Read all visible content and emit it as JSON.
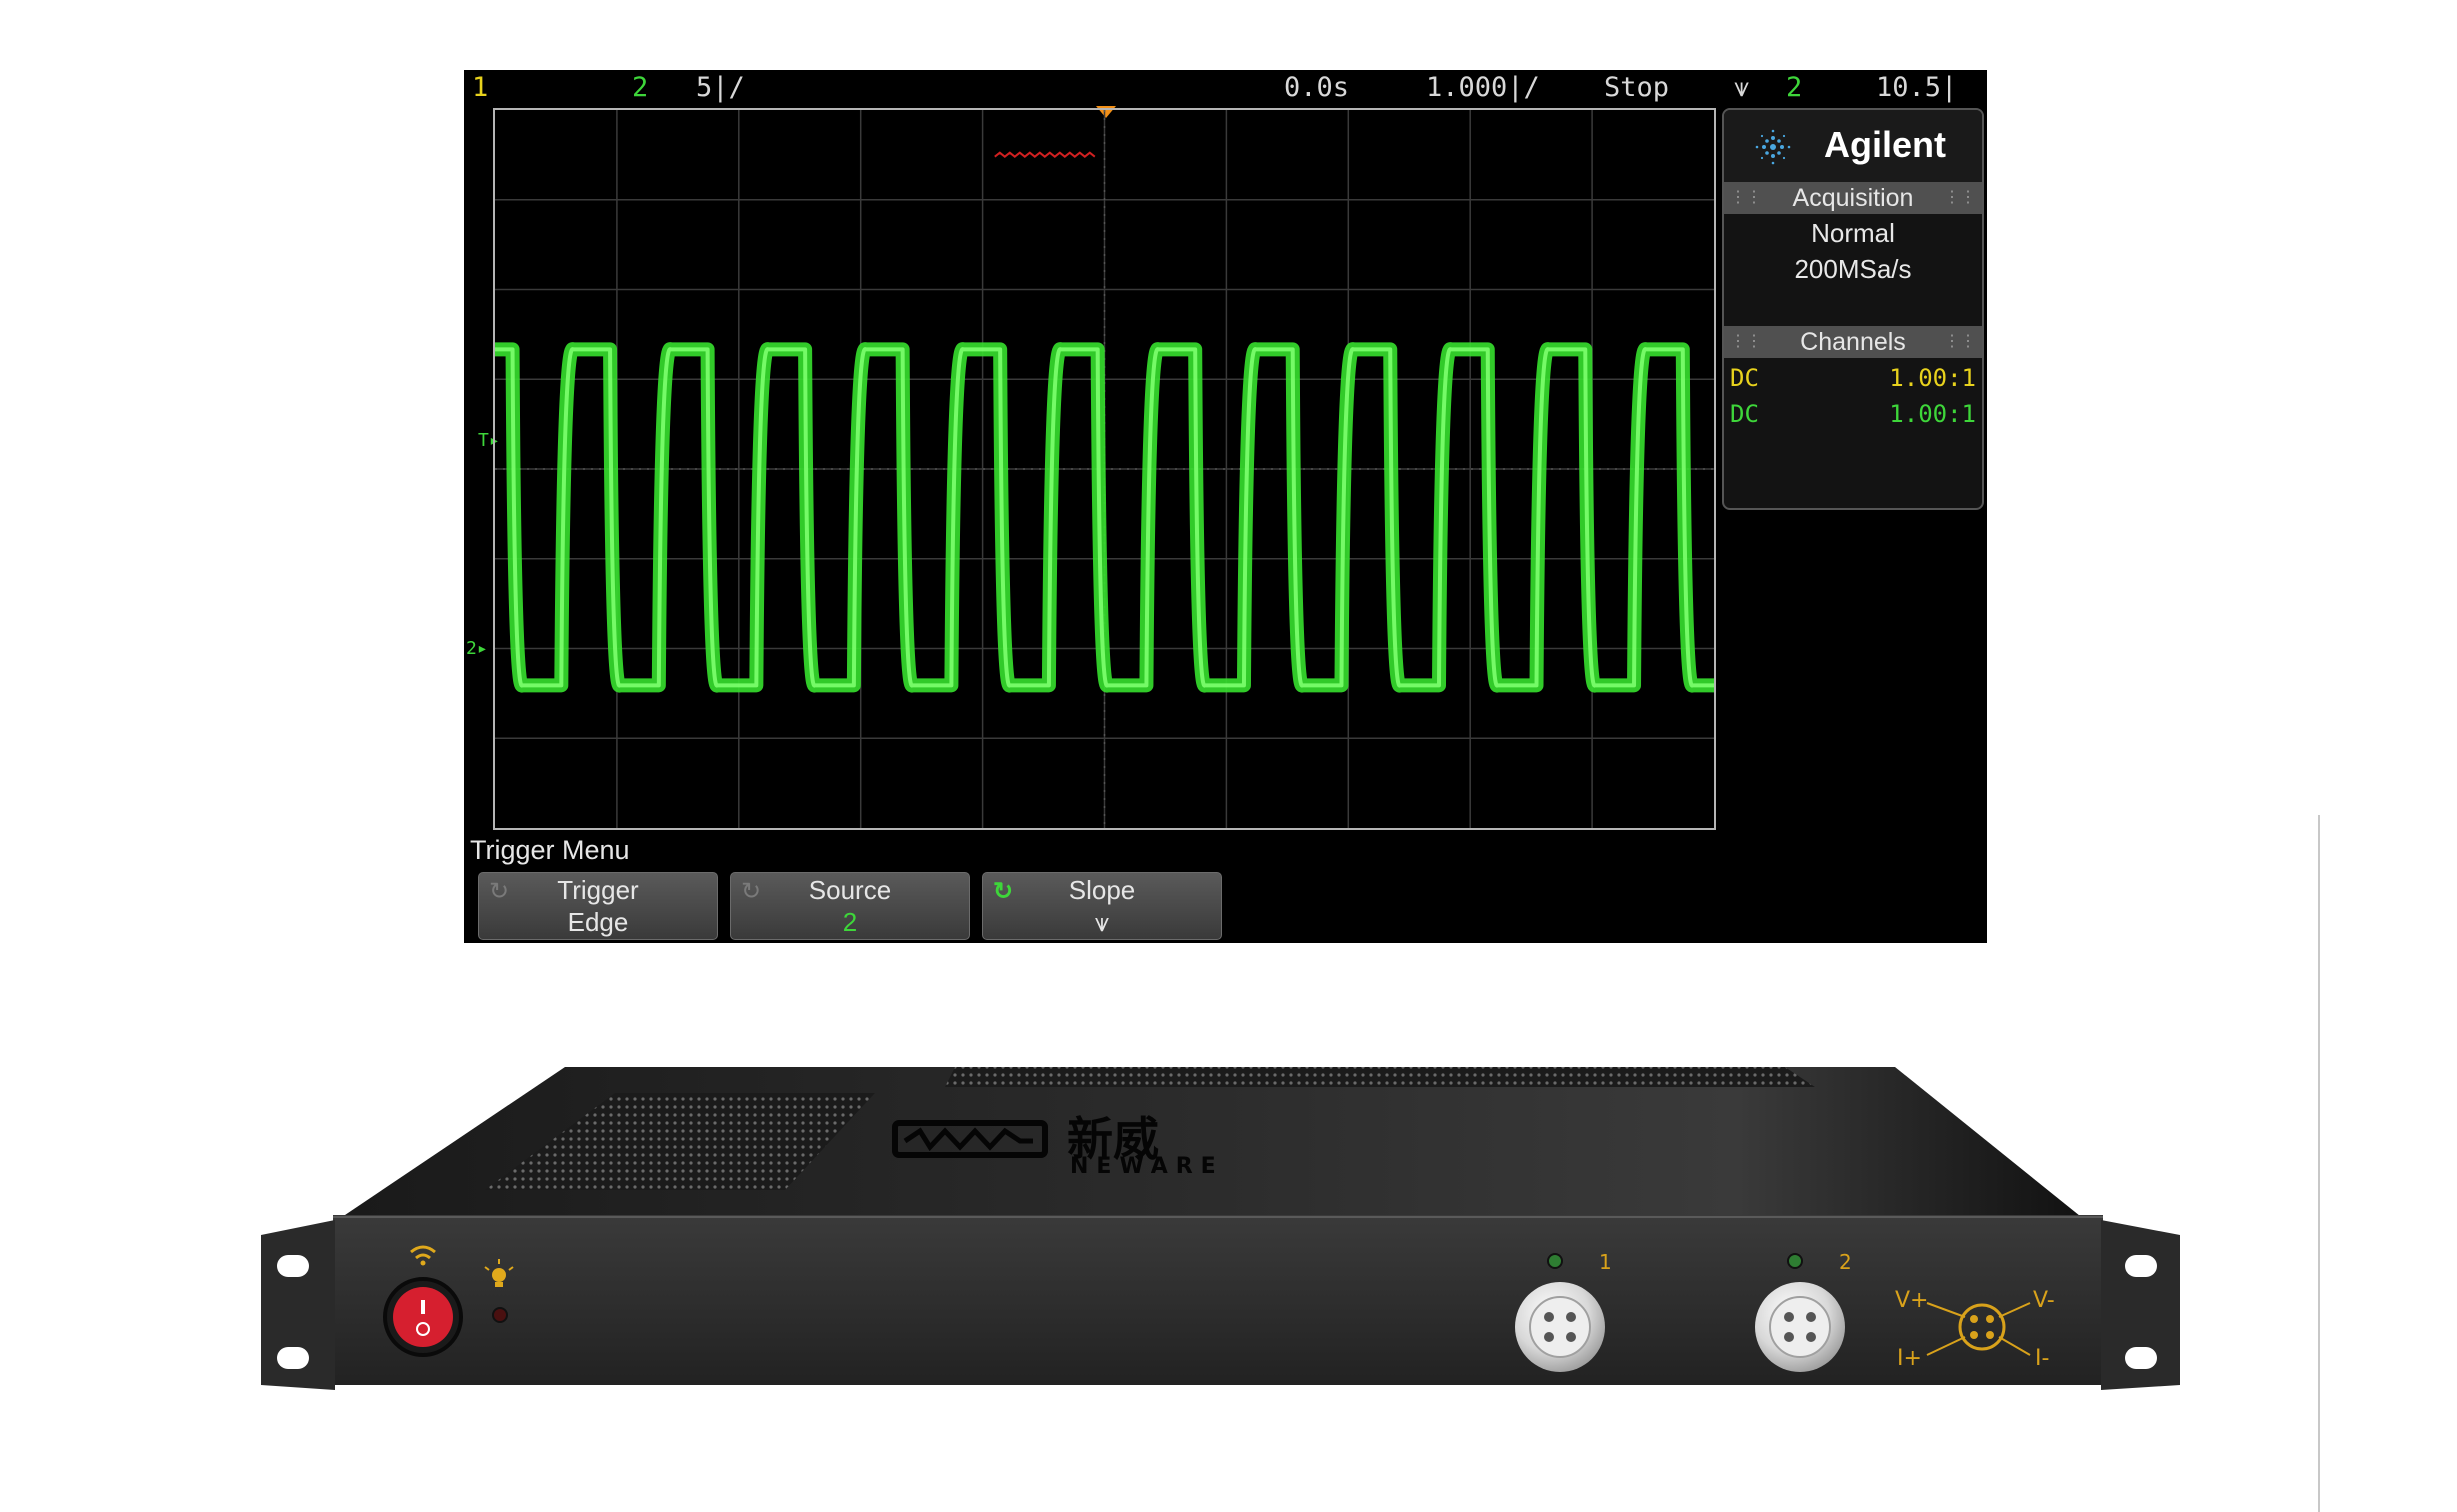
{
  "scope": {
    "topbar": {
      "ch1": "1",
      "ch2": "2",
      "ch2_scale": "5∣/",
      "time_pos": "0.0s",
      "time_scale": "1.000∣/",
      "run_state": "Stop",
      "trig_slope": "⩛",
      "trig_source": "2",
      "trig_level": "10.5∣"
    },
    "brand": "Agilent",
    "acquisition": {
      "heading": "Acquisition",
      "mode": "Normal",
      "rate": "200MSa/s"
    },
    "channels": {
      "heading": "Channels",
      "rows": [
        {
          "coupling": "DC",
          "probe": "1.00:1",
          "color": "#e8d21d"
        },
        {
          "coupling": "DC",
          "probe": "1.00:1",
          "color": "#3ed63a"
        }
      ]
    },
    "markers": {
      "trigger": "T",
      "ch2": "2"
    },
    "menu": {
      "title": "Trigger Menu",
      "keys": [
        {
          "title": "Trigger",
          "value": "Edge"
        },
        {
          "title": "Source",
          "value": "2"
        },
        {
          "title": "Slope",
          "value": "⩛"
        }
      ]
    },
    "waveform": {
      "cycles": 12.5,
      "trace_color": "#36e02e",
      "high_div": -2.6,
      "low_div": 4.7
    }
  },
  "device": {
    "brand_cn": "新威",
    "brand_en": "NEWARE",
    "port1_label": "1",
    "port2_label": "2",
    "pin_labels": {
      "v_plus": "V+",
      "v_minus": "V-",
      "i_plus": "I+",
      "i_minus": "I-"
    }
  },
  "colors": {
    "accent_orange": "#f29018",
    "trace_green": "#36e02e",
    "label_yellow": "#e8d21d",
    "pin_gold": "#d9a21b"
  }
}
